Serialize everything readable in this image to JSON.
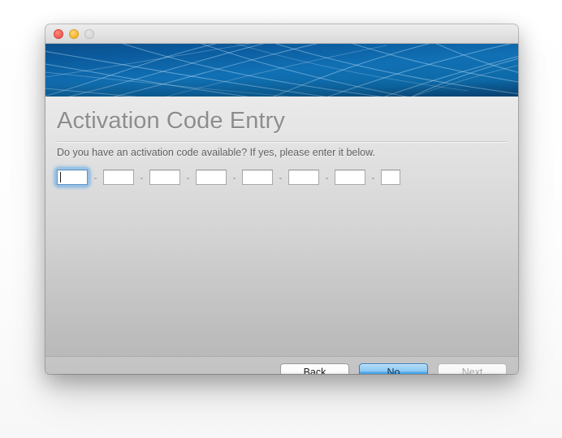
{
  "window": {
    "traffic_lights": [
      {
        "name": "close",
        "color": "#f4645c"
      },
      {
        "name": "minimize",
        "color": "#f9bc3a"
      },
      {
        "name": "zoom",
        "color": "#dcdcdc"
      }
    ]
  },
  "banner": {
    "base_color": "#0f6aac",
    "accent_color": "#a9d8f5"
  },
  "page": {
    "title": "Activation Code Entry",
    "prompt": "Do you have an activation code available? If yes, please enter it below."
  },
  "code_entry": {
    "separator": "-",
    "focused_index": 0,
    "focus_ring_color": "#6eb0e8",
    "segments": [
      {
        "value": "",
        "width": "wide"
      },
      {
        "value": "",
        "width": "wide"
      },
      {
        "value": "",
        "width": "wide"
      },
      {
        "value": "",
        "width": "wide"
      },
      {
        "value": "",
        "width": "wide"
      },
      {
        "value": "",
        "width": "wide"
      },
      {
        "value": "",
        "width": "wide"
      },
      {
        "value": "",
        "width": "narrow"
      }
    ]
  },
  "footer": {
    "buttons": [
      {
        "label": "Back",
        "state": "normal"
      },
      {
        "label": "No",
        "state": "default"
      },
      {
        "label": "Next",
        "state": "disabled"
      }
    ]
  }
}
